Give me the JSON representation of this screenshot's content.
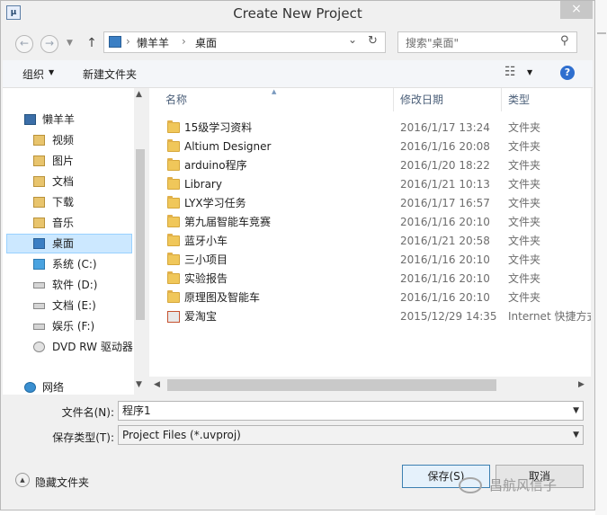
{
  "window": {
    "title": "Create New Project",
    "close_glyph": "×"
  },
  "nav": {
    "back_glyph": "←",
    "forward_glyph": "→",
    "up_glyph": "↑",
    "breadcrumb": [
      "懒羊羊",
      "桌面"
    ],
    "breadcrumb_sep": "›",
    "dropdown_glyph": "⌄",
    "refresh_glyph": "↻"
  },
  "search": {
    "placeholder": "搜索\"桌面\"",
    "icon_glyph": "⚲"
  },
  "toolbar": {
    "organize_label": "组织",
    "organize_arrow": "▼",
    "new_folder_label": "新建文件夹",
    "view_glyph": "☷",
    "view_arrow": "▼",
    "help_glyph": "?"
  },
  "sidebar": {
    "items": [
      {
        "label": "懒羊羊",
        "icon": "computer-icon"
      },
      {
        "label": "视频",
        "icon": "video-library-icon"
      },
      {
        "label": "图片",
        "icon": "pictures-library-icon"
      },
      {
        "label": "文档",
        "icon": "documents-library-icon"
      },
      {
        "label": "下载",
        "icon": "downloads-icon"
      },
      {
        "label": "音乐",
        "icon": "music-library-icon"
      },
      {
        "label": "桌面",
        "icon": "desktop-icon",
        "selected": true
      },
      {
        "label": "系统 (C:)",
        "icon": "system-drive-icon"
      },
      {
        "label": "软件 (D:)",
        "icon": "drive-icon"
      },
      {
        "label": "文档 (E:)",
        "icon": "drive-icon"
      },
      {
        "label": "娱乐 (F:)",
        "icon": "drive-icon"
      },
      {
        "label": "DVD RW 驱动器",
        "icon": "dvd-drive-icon"
      },
      {
        "label": "网络",
        "icon": "network-icon"
      }
    ]
  },
  "filelist": {
    "columns": {
      "name": "名称",
      "date": "修改日期",
      "type": "类型"
    },
    "rows": [
      {
        "name": "15级学习资料",
        "date": "2016/1/17 13:24",
        "type": "文件夹",
        "icon": "folder-icon"
      },
      {
        "name": "Altium Designer",
        "date": "2016/1/16 20:08",
        "type": "文件夹",
        "icon": "folder-icon"
      },
      {
        "name": "arduino程序",
        "date": "2016/1/20 18:22",
        "type": "文件夹",
        "icon": "folder-icon"
      },
      {
        "name": "Library",
        "date": "2016/1/21 10:13",
        "type": "文件夹",
        "icon": "folder-icon"
      },
      {
        "name": "LYX学习任务",
        "date": "2016/1/17 16:57",
        "type": "文件夹",
        "icon": "folder-icon"
      },
      {
        "name": "第九届智能车竞赛",
        "date": "2016/1/16 20:10",
        "type": "文件夹",
        "icon": "folder-icon"
      },
      {
        "name": "蓝牙小车",
        "date": "2016/1/21 20:58",
        "type": "文件夹",
        "icon": "folder-icon"
      },
      {
        "name": "三小项目",
        "date": "2016/1/16 20:10",
        "type": "文件夹",
        "icon": "folder-icon"
      },
      {
        "name": "实验报告",
        "date": "2016/1/16 20:10",
        "type": "文件夹",
        "icon": "folder-icon"
      },
      {
        "name": "原理图及智能车",
        "date": "2016/1/16 20:10",
        "type": "文件夹",
        "icon": "folder-icon"
      },
      {
        "name": "爱淘宝",
        "date": "2015/12/29 14:35",
        "type": "Internet 快捷方式",
        "icon": "internet-shortcut-icon"
      }
    ]
  },
  "form": {
    "filename_label": "文件名(N):",
    "filename_value": "程序1",
    "filetype_label": "保存类型(T):",
    "filetype_value": "Project Files (*.uvproj)",
    "combo_arrow": "▼"
  },
  "footer": {
    "hide_folders_label": "隐藏文件夹",
    "hide_folders_glyph": "▲",
    "save_label": "保存(S)",
    "cancel_label": "取消",
    "watermark": "昌航风信子"
  },
  "scroll": {
    "up": "▲",
    "down": "▼",
    "left": "◀",
    "right": "▶"
  },
  "colors": {
    "accent": "#3c7fb1",
    "selected_bg": "#cce8ff",
    "folder": "#f0c75a"
  }
}
